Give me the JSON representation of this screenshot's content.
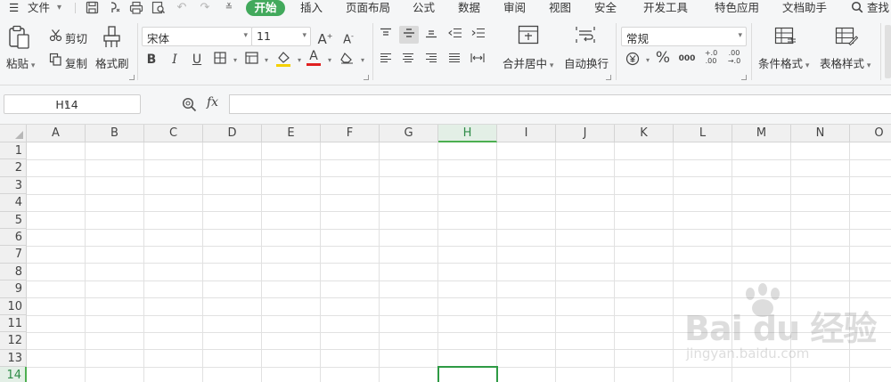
{
  "menubar": {
    "file_label": "文件",
    "tabs": [
      "开始",
      "插入",
      "页面布局",
      "公式",
      "数据",
      "审阅",
      "视图",
      "安全",
      "开发工具",
      "特色应用",
      "文档助手"
    ],
    "active_tab": "开始",
    "search_label": "查找",
    "accent_color": "#42a95c"
  },
  "ribbon": {
    "clipboard": {
      "paste_label": "粘贴",
      "cut_label": "剪切",
      "copy_label": "复制",
      "format_painter_label": "格式刷"
    },
    "font": {
      "font_name": "宋体",
      "font_size": "11",
      "bold": "B",
      "italic": "I",
      "underline": "U",
      "font_color": "#e02020",
      "fill_color": "#f5d000"
    },
    "alignment": {
      "merge_center_label": "合并居中",
      "wrap_text_label": "自动换行"
    },
    "number": {
      "format_value": "常规",
      "percent": "%",
      "thousands": "000",
      "inc_decimal": "+.0\n.00",
      "dec_decimal": ".00\n→.0"
    },
    "styles": {
      "conditional_format_label": "条件格式",
      "table_style_label": "表格样式"
    }
  },
  "formula_bar": {
    "cell_ref": "H14",
    "fx_label": "fx",
    "formula_value": ""
  },
  "sheet": {
    "columns": [
      "A",
      "B",
      "C",
      "D",
      "E",
      "F",
      "G",
      "H",
      "I",
      "J",
      "K",
      "L",
      "M",
      "N",
      "O"
    ],
    "rows": [
      "1",
      "2",
      "3",
      "4",
      "5",
      "6",
      "7",
      "8",
      "9",
      "10",
      "11",
      "12",
      "13",
      "14"
    ],
    "selected_column": "H",
    "selected_row": "14",
    "selection_color": "#2e9a44"
  },
  "watermark": {
    "brand": "Bai du 经验",
    "url": "jingyan.baidu.com"
  }
}
